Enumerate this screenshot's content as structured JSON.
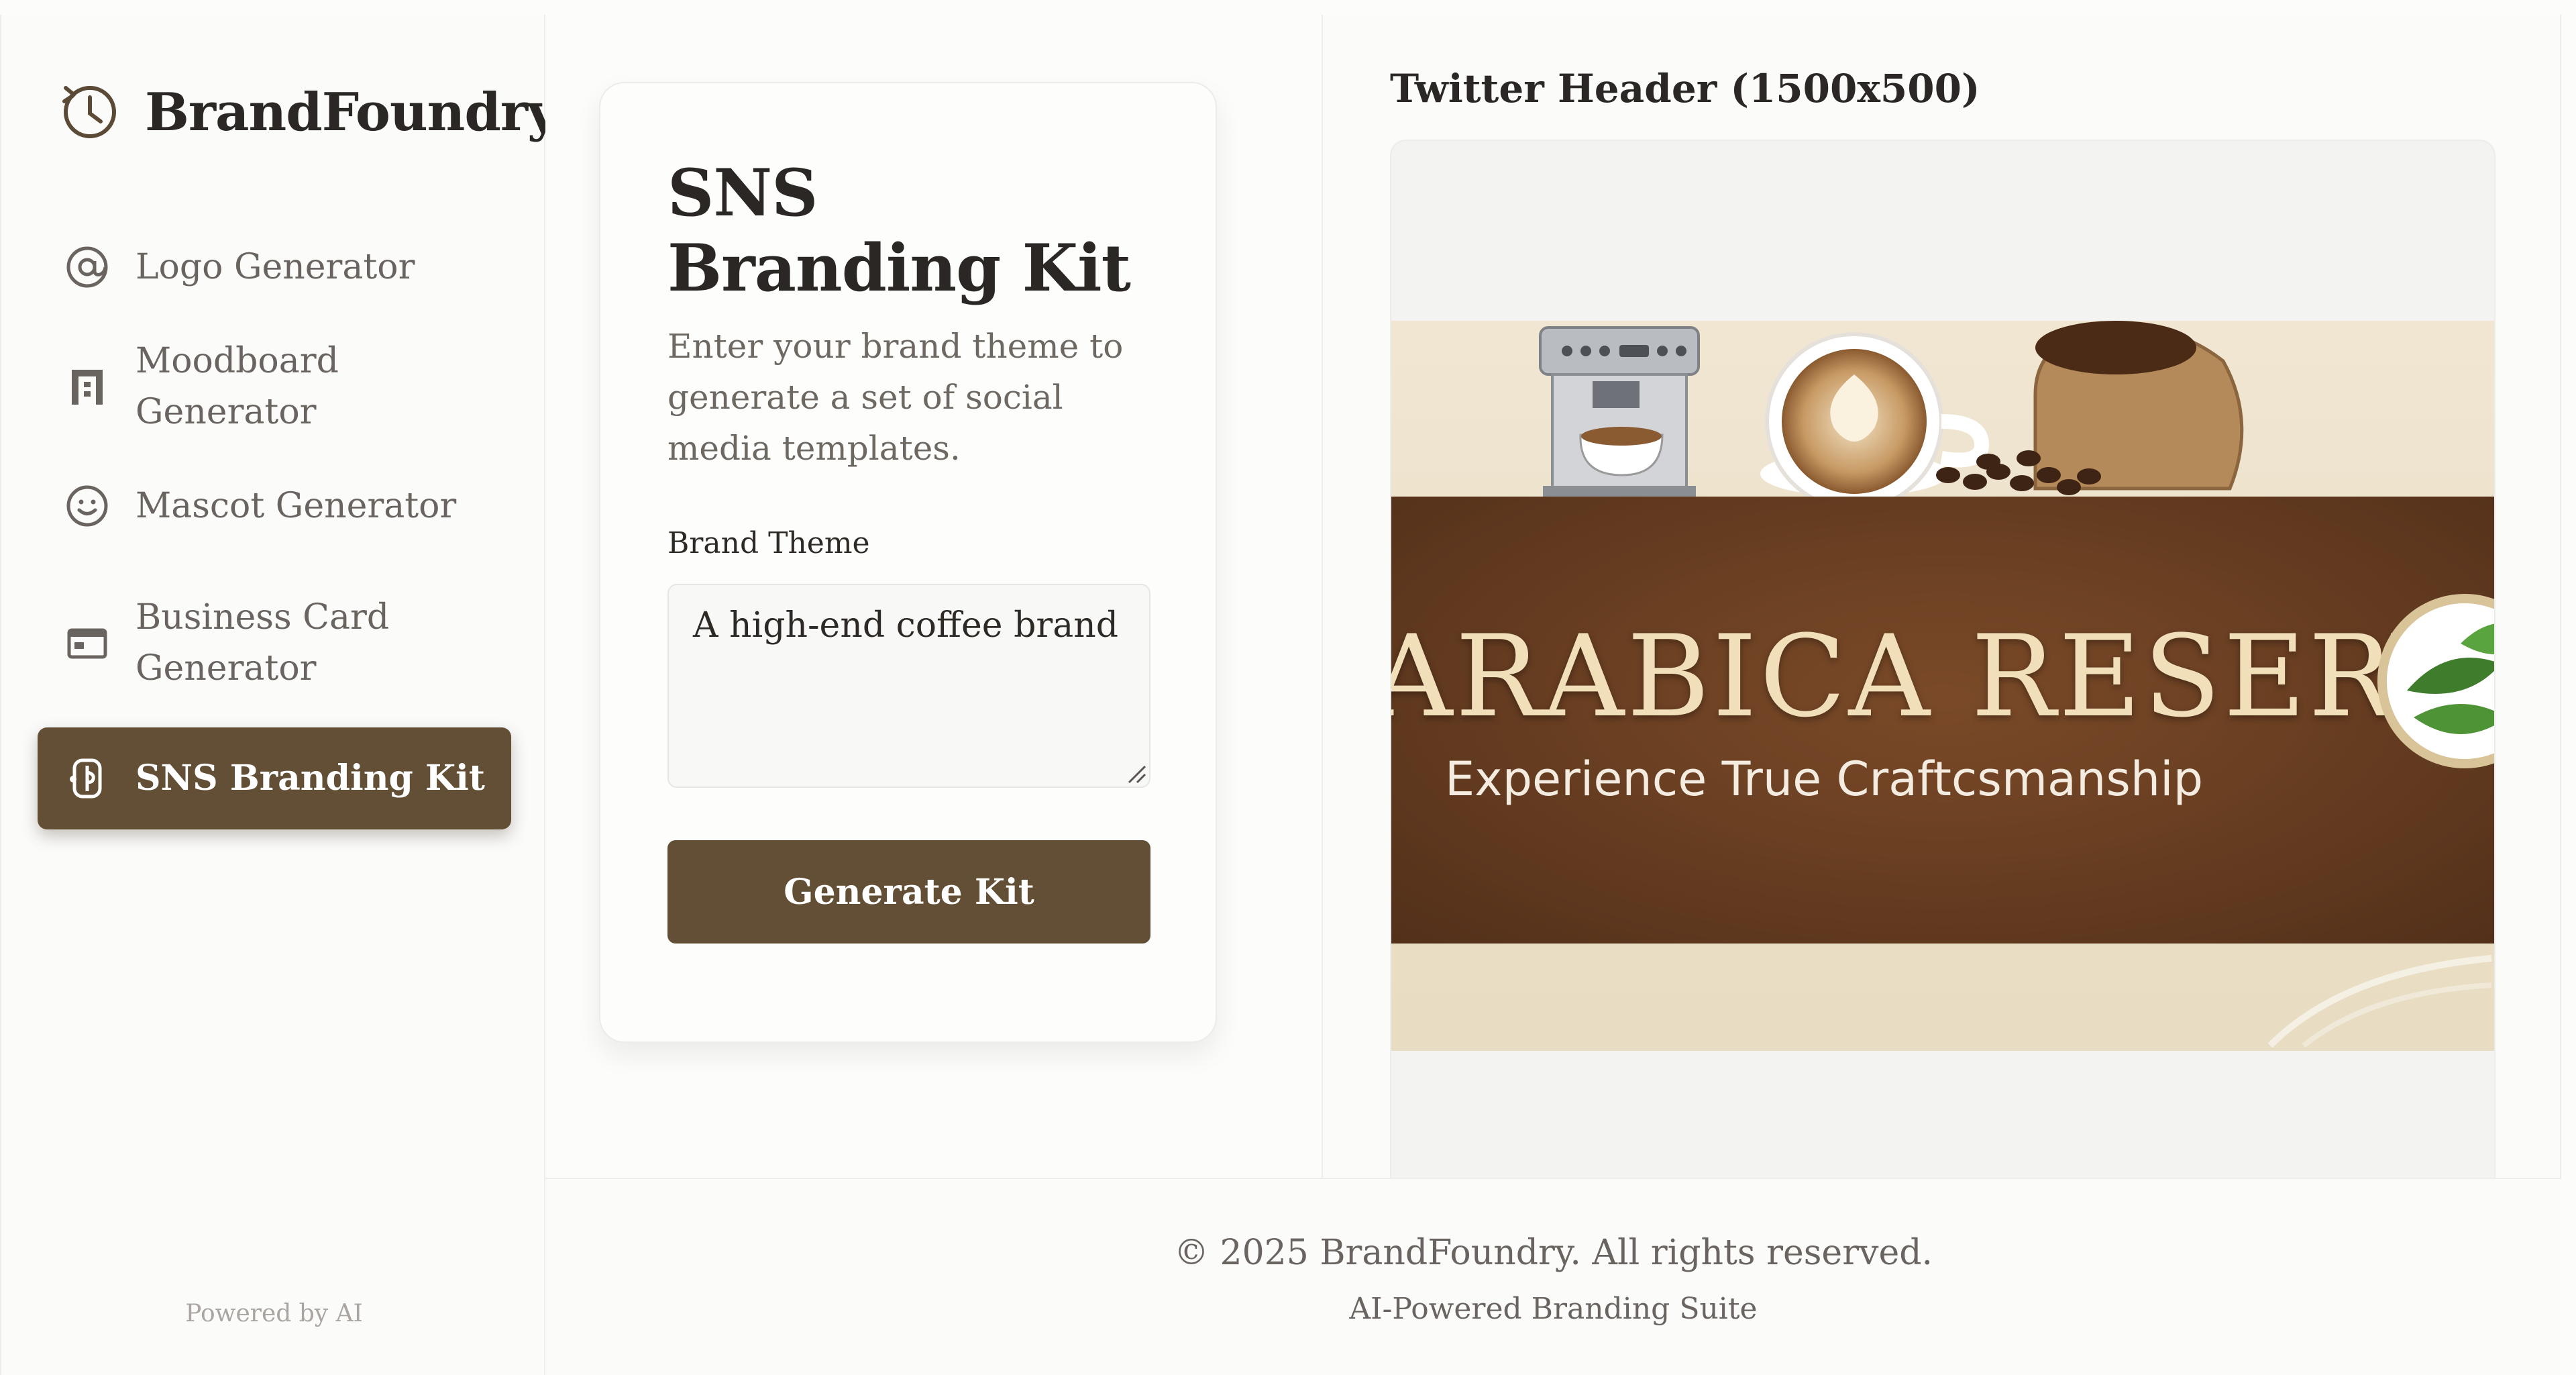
{
  "sidebar": {
    "brand_name": "BrandFoundry",
    "brand_icon": "clock-icon",
    "items": [
      {
        "label": "Logo Generator",
        "icon": "at-sign-icon",
        "active": false
      },
      {
        "label": "Moodboard Generator",
        "icon": "board-icon",
        "active": false
      },
      {
        "label": "Mascot Generator",
        "icon": "smile-icon",
        "active": false
      },
      {
        "label": "Business Card Generator",
        "icon": "card-icon",
        "active": false
      },
      {
        "label": "SNS Branding Kit",
        "icon": "share-icon",
        "active": true
      }
    ],
    "powered_by": "Powered by AI"
  },
  "form": {
    "title": "SNS Branding Kit",
    "description": "Enter your brand theme to generate a set of social media templates.",
    "field_label": "Brand Theme",
    "field_value": "A high-end coffee brand",
    "button_label": "Generate Kit"
  },
  "preview": {
    "title": "Twitter Header (1500x500)",
    "banner_name": "ARABICA RESERVE",
    "banner_tagline": "Experience True Craftcsmanship"
  },
  "footer": {
    "copyright": "© 2025 BrandFoundry. All rights reserved.",
    "tagline": "AI-Powered Branding Suite"
  },
  "colors": {
    "accent": "#624f36",
    "banner_brown": "#6a3f22",
    "banner_cream": "#efe4cf",
    "text_dark": "#2b2724",
    "text_muted": "#6a6460"
  }
}
